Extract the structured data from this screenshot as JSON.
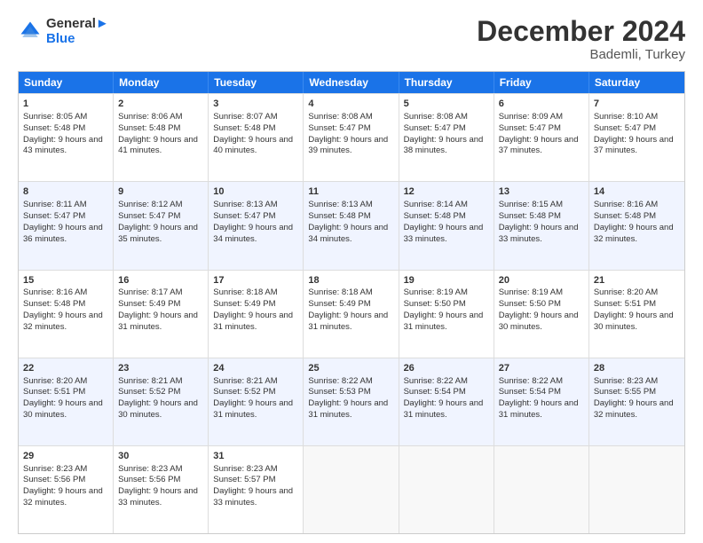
{
  "header": {
    "logo_line1": "General",
    "logo_line2": "Blue",
    "main_title": "December 2024",
    "subtitle": "Bademli, Turkey"
  },
  "calendar": {
    "days": [
      "Sunday",
      "Monday",
      "Tuesday",
      "Wednesday",
      "Thursday",
      "Friday",
      "Saturday"
    ],
    "rows": [
      [
        {
          "day": "1",
          "sunrise": "Sunrise: 8:05 AM",
          "sunset": "Sunset: 5:48 PM",
          "daylight": "Daylight: 9 hours and 43 minutes."
        },
        {
          "day": "2",
          "sunrise": "Sunrise: 8:06 AM",
          "sunset": "Sunset: 5:48 PM",
          "daylight": "Daylight: 9 hours and 41 minutes."
        },
        {
          "day": "3",
          "sunrise": "Sunrise: 8:07 AM",
          "sunset": "Sunset: 5:48 PM",
          "daylight": "Daylight: 9 hours and 40 minutes."
        },
        {
          "day": "4",
          "sunrise": "Sunrise: 8:08 AM",
          "sunset": "Sunset: 5:47 PM",
          "daylight": "Daylight: 9 hours and 39 minutes."
        },
        {
          "day": "5",
          "sunrise": "Sunrise: 8:08 AM",
          "sunset": "Sunset: 5:47 PM",
          "daylight": "Daylight: 9 hours and 38 minutes."
        },
        {
          "day": "6",
          "sunrise": "Sunrise: 8:09 AM",
          "sunset": "Sunset: 5:47 PM",
          "daylight": "Daylight: 9 hours and 37 minutes."
        },
        {
          "day": "7",
          "sunrise": "Sunrise: 8:10 AM",
          "sunset": "Sunset: 5:47 PM",
          "daylight": "Daylight: 9 hours and 37 minutes."
        }
      ],
      [
        {
          "day": "8",
          "sunrise": "Sunrise: 8:11 AM",
          "sunset": "Sunset: 5:47 PM",
          "daylight": "Daylight: 9 hours and 36 minutes."
        },
        {
          "day": "9",
          "sunrise": "Sunrise: 8:12 AM",
          "sunset": "Sunset: 5:47 PM",
          "daylight": "Daylight: 9 hours and 35 minutes."
        },
        {
          "day": "10",
          "sunrise": "Sunrise: 8:13 AM",
          "sunset": "Sunset: 5:47 PM",
          "daylight": "Daylight: 9 hours and 34 minutes."
        },
        {
          "day": "11",
          "sunrise": "Sunrise: 8:13 AM",
          "sunset": "Sunset: 5:48 PM",
          "daylight": "Daylight: 9 hours and 34 minutes."
        },
        {
          "day": "12",
          "sunrise": "Sunrise: 8:14 AM",
          "sunset": "Sunset: 5:48 PM",
          "daylight": "Daylight: 9 hours and 33 minutes."
        },
        {
          "day": "13",
          "sunrise": "Sunrise: 8:15 AM",
          "sunset": "Sunset: 5:48 PM",
          "daylight": "Daylight: 9 hours and 33 minutes."
        },
        {
          "day": "14",
          "sunrise": "Sunrise: 8:16 AM",
          "sunset": "Sunset: 5:48 PM",
          "daylight": "Daylight: 9 hours and 32 minutes."
        }
      ],
      [
        {
          "day": "15",
          "sunrise": "Sunrise: 8:16 AM",
          "sunset": "Sunset: 5:48 PM",
          "daylight": "Daylight: 9 hours and 32 minutes."
        },
        {
          "day": "16",
          "sunrise": "Sunrise: 8:17 AM",
          "sunset": "Sunset: 5:49 PM",
          "daylight": "Daylight: 9 hours and 31 minutes."
        },
        {
          "day": "17",
          "sunrise": "Sunrise: 8:18 AM",
          "sunset": "Sunset: 5:49 PM",
          "daylight": "Daylight: 9 hours and 31 minutes."
        },
        {
          "day": "18",
          "sunrise": "Sunrise: 8:18 AM",
          "sunset": "Sunset: 5:49 PM",
          "daylight": "Daylight: 9 hours and 31 minutes."
        },
        {
          "day": "19",
          "sunrise": "Sunrise: 8:19 AM",
          "sunset": "Sunset: 5:50 PM",
          "daylight": "Daylight: 9 hours and 31 minutes."
        },
        {
          "day": "20",
          "sunrise": "Sunrise: 8:19 AM",
          "sunset": "Sunset: 5:50 PM",
          "daylight": "Daylight: 9 hours and 30 minutes."
        },
        {
          "day": "21",
          "sunrise": "Sunrise: 8:20 AM",
          "sunset": "Sunset: 5:51 PM",
          "daylight": "Daylight: 9 hours and 30 minutes."
        }
      ],
      [
        {
          "day": "22",
          "sunrise": "Sunrise: 8:20 AM",
          "sunset": "Sunset: 5:51 PM",
          "daylight": "Daylight: 9 hours and 30 minutes."
        },
        {
          "day": "23",
          "sunrise": "Sunrise: 8:21 AM",
          "sunset": "Sunset: 5:52 PM",
          "daylight": "Daylight: 9 hours and 30 minutes."
        },
        {
          "day": "24",
          "sunrise": "Sunrise: 8:21 AM",
          "sunset": "Sunset: 5:52 PM",
          "daylight": "Daylight: 9 hours and 31 minutes."
        },
        {
          "day": "25",
          "sunrise": "Sunrise: 8:22 AM",
          "sunset": "Sunset: 5:53 PM",
          "daylight": "Daylight: 9 hours and 31 minutes."
        },
        {
          "day": "26",
          "sunrise": "Sunrise: 8:22 AM",
          "sunset": "Sunset: 5:54 PM",
          "daylight": "Daylight: 9 hours and 31 minutes."
        },
        {
          "day": "27",
          "sunrise": "Sunrise: 8:22 AM",
          "sunset": "Sunset: 5:54 PM",
          "daylight": "Daylight: 9 hours and 31 minutes."
        },
        {
          "day": "28",
          "sunrise": "Sunrise: 8:23 AM",
          "sunset": "Sunset: 5:55 PM",
          "daylight": "Daylight: 9 hours and 32 minutes."
        }
      ],
      [
        {
          "day": "29",
          "sunrise": "Sunrise: 8:23 AM",
          "sunset": "Sunset: 5:56 PM",
          "daylight": "Daylight: 9 hours and 32 minutes."
        },
        {
          "day": "30",
          "sunrise": "Sunrise: 8:23 AM",
          "sunset": "Sunset: 5:56 PM",
          "daylight": "Daylight: 9 hours and 33 minutes."
        },
        {
          "day": "31",
          "sunrise": "Sunrise: 8:23 AM",
          "sunset": "Sunset: 5:57 PM",
          "daylight": "Daylight: 9 hours and 33 minutes."
        },
        null,
        null,
        null,
        null
      ]
    ]
  }
}
